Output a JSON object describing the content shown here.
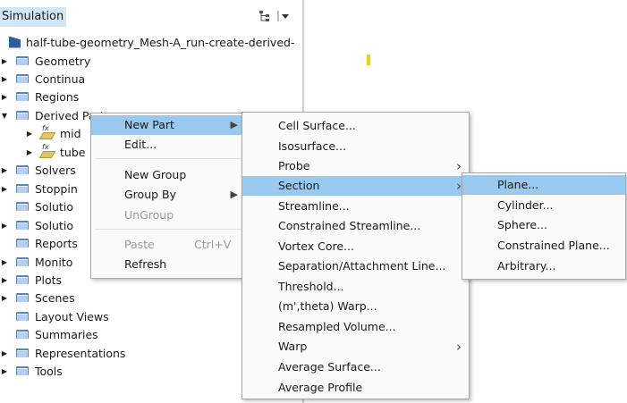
{
  "panel": {
    "title": "Simulation",
    "tree_icon": "tree-view-icon",
    "menu_icon": "panel-menu-icon"
  },
  "tree": {
    "root": "half-tube-geometry_Mesh-A_run-create-derived-",
    "items": [
      {
        "label": "Geometry",
        "expanded": false
      },
      {
        "label": "Continua",
        "expanded": false
      },
      {
        "label": "Regions",
        "expanded": false
      },
      {
        "label": "Derived Parts",
        "expanded": true
      },
      {
        "label": "mid",
        "child": true
      },
      {
        "label": "tube",
        "child": true
      },
      {
        "label": "Solvers",
        "expanded": false
      },
      {
        "label": "Stoppin",
        "expanded": false
      },
      {
        "label": "Solutio",
        "expanded": false,
        "no_arrow": true
      },
      {
        "label": "Solutio",
        "expanded": false
      },
      {
        "label": "Reports",
        "expanded": false,
        "no_arrow": true
      },
      {
        "label": "Monito",
        "expanded": false
      },
      {
        "label": "Plots",
        "expanded": false
      },
      {
        "label": "Scenes",
        "expanded": false
      },
      {
        "label": "Layout Views",
        "expanded": false,
        "no_arrow": true
      },
      {
        "label": "Summaries",
        "expanded": false,
        "no_arrow": true
      },
      {
        "label": "Representations",
        "expanded": false
      },
      {
        "label": "Tools",
        "expanded": false
      }
    ]
  },
  "context_menu": {
    "new_part": "New Part",
    "edit": "Edit...",
    "new_group": "New Group",
    "group_by": "Group By",
    "ungroup": "UnGroup",
    "paste": "Paste",
    "paste_shortcut": "Ctrl+V",
    "refresh": "Refresh"
  },
  "new_part_menu": {
    "items": [
      "Cell Surface...",
      "Isosurface...",
      "Probe",
      "Section",
      "Streamline...",
      "Constrained Streamline...",
      "Vortex Core...",
      "Separation/Attachment Line...",
      "Threshold...",
      "(m',theta) Warp...",
      "Resampled Volume...",
      "Warp",
      "Average Surface...",
      "Average Profile"
    ]
  },
  "section_menu": {
    "items": [
      "Plane...",
      "Cylinder...",
      "Sphere...",
      "Constrained Plane...",
      "Arbitrary..."
    ]
  },
  "colors": {
    "highlight": "#99c9ef",
    "header": "#d2e7f5",
    "folder": "#5a84bf"
  }
}
